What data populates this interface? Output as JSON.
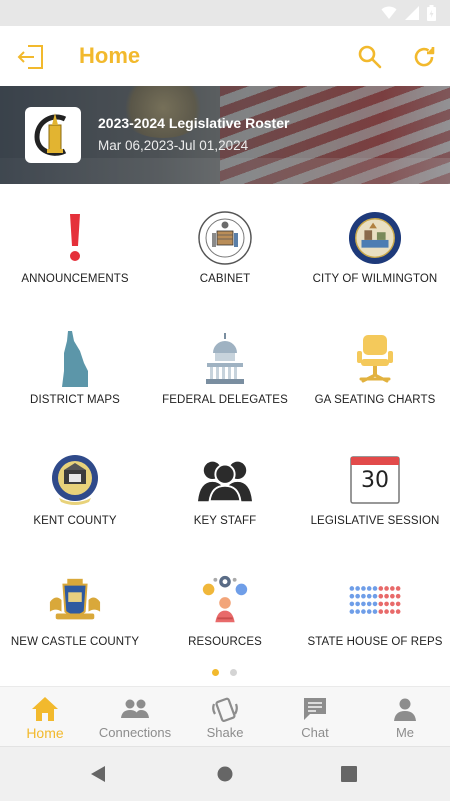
{
  "appbar": {
    "title": "Home"
  },
  "banner": {
    "title": "2023-2024 Legislative Roster",
    "dates": "Mar 06,2023-Jul 01,2024"
  },
  "grid": {
    "items": [
      {
        "label": "ANNOUNCEMENTS",
        "icon": "exclamation-icon"
      },
      {
        "label": "CABINET",
        "icon": "state-seal-icon"
      },
      {
        "label": "CITY OF WILMINGTON",
        "icon": "city-seal-icon"
      },
      {
        "label": "DISTRICT MAPS",
        "icon": "delaware-map-icon"
      },
      {
        "label": "FEDERAL DELEGATES",
        "icon": "capitol-icon"
      },
      {
        "label": "GA SEATING CHARTS",
        "icon": "chair-icon"
      },
      {
        "label": "KENT COUNTY",
        "icon": "county-seal-icon"
      },
      {
        "label": "KEY STAFF",
        "icon": "people-icon"
      },
      {
        "label": "LEGISLATIVE SESSION",
        "icon": "calendar-icon",
        "calendar_day": "30"
      },
      {
        "label": "NEW CASTLE COUNTY",
        "icon": "new-castle-crest-icon"
      },
      {
        "label": "RESOURCES",
        "icon": "resources-icon"
      },
      {
        "label": "STATE HOUSE OF REPS",
        "icon": "seating-dots-icon"
      }
    ]
  },
  "pager": {
    "pages": 2,
    "active": 1
  },
  "bottom_nav": {
    "items": [
      {
        "label": "Home",
        "icon": "home-icon",
        "active": true
      },
      {
        "label": "Connections",
        "icon": "connections-icon",
        "active": false
      },
      {
        "label": "Shake",
        "icon": "shake-icon",
        "active": false
      },
      {
        "label": "Chat",
        "icon": "chat-icon",
        "active": false
      },
      {
        "label": "Me",
        "icon": "person-icon",
        "active": false
      }
    ]
  },
  "colors": {
    "accent": "#f2b92d",
    "inactive": "#8d8d8d",
    "exclamation": "#e5303a",
    "map": "#5c96a9",
    "chair": "#f4c95b",
    "dots_blue": "#6f9ee8",
    "dots_red": "#e86a6a"
  }
}
